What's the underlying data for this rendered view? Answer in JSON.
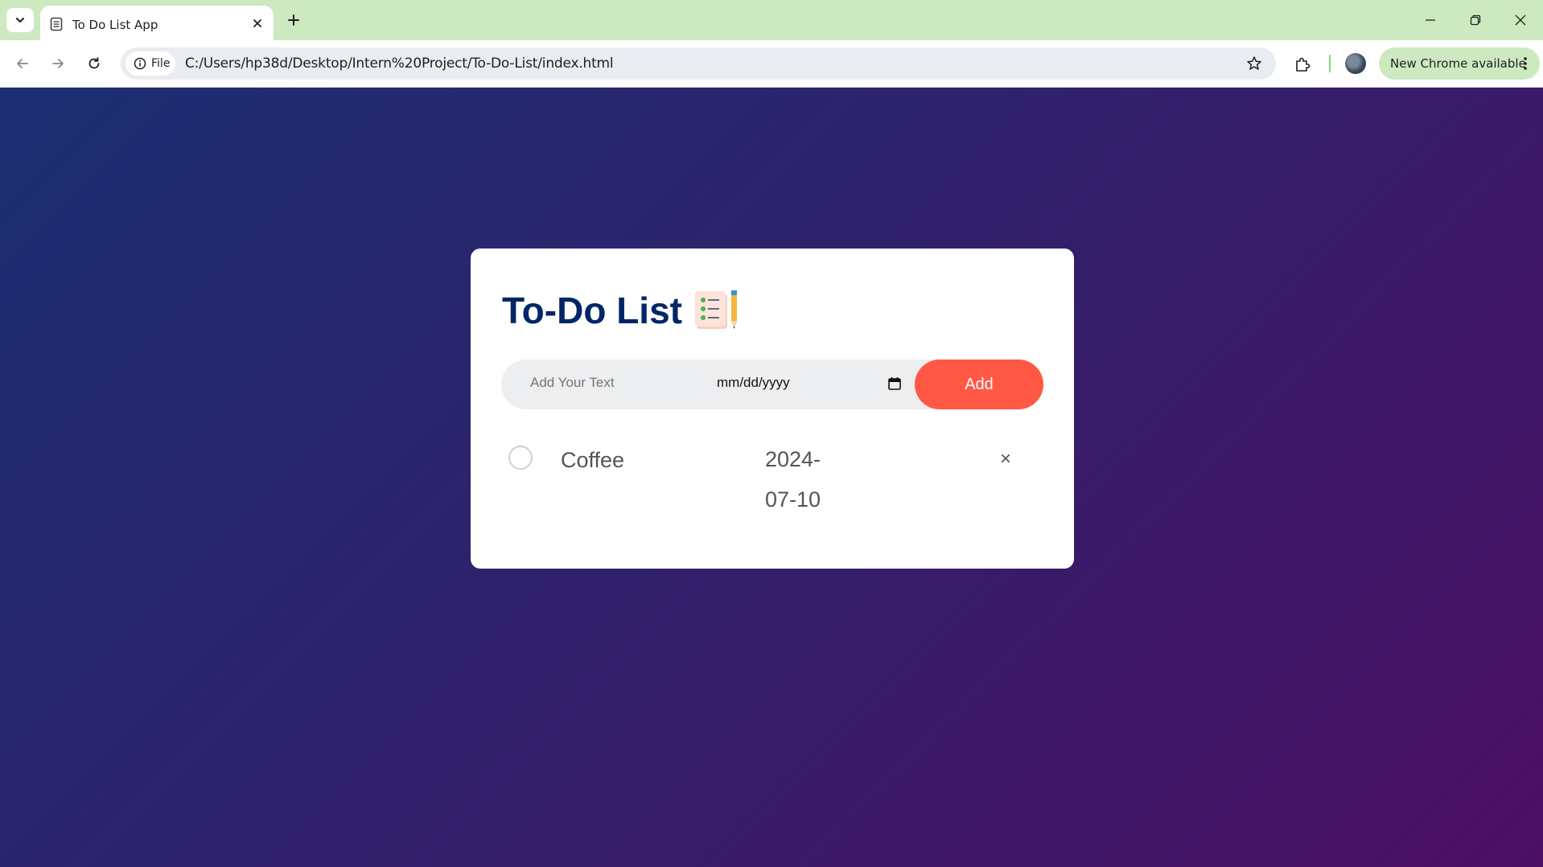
{
  "browser": {
    "tab_title": "To Do List App",
    "site_info_label": "File",
    "url": "C:/Users/hp38d/Desktop/Intern%20Project/To-Do-List/index.html",
    "update_label": "New Chrome available"
  },
  "app": {
    "title": "To-Do List",
    "input_placeholder": "Add Your Text",
    "date_placeholder": "mm/dd/yyyy",
    "add_label": "Add",
    "tasks": [
      {
        "text": "Coffee",
        "date": "2024-07-10",
        "checked": false,
        "delete_label": "×"
      }
    ]
  },
  "colors": {
    "title": "#002765",
    "accent": "#ff5945",
    "bg_gradient_start": "#1c2f72",
    "bg_gradient_end": "#4b0f62",
    "tabbar": "#cde9bf"
  }
}
